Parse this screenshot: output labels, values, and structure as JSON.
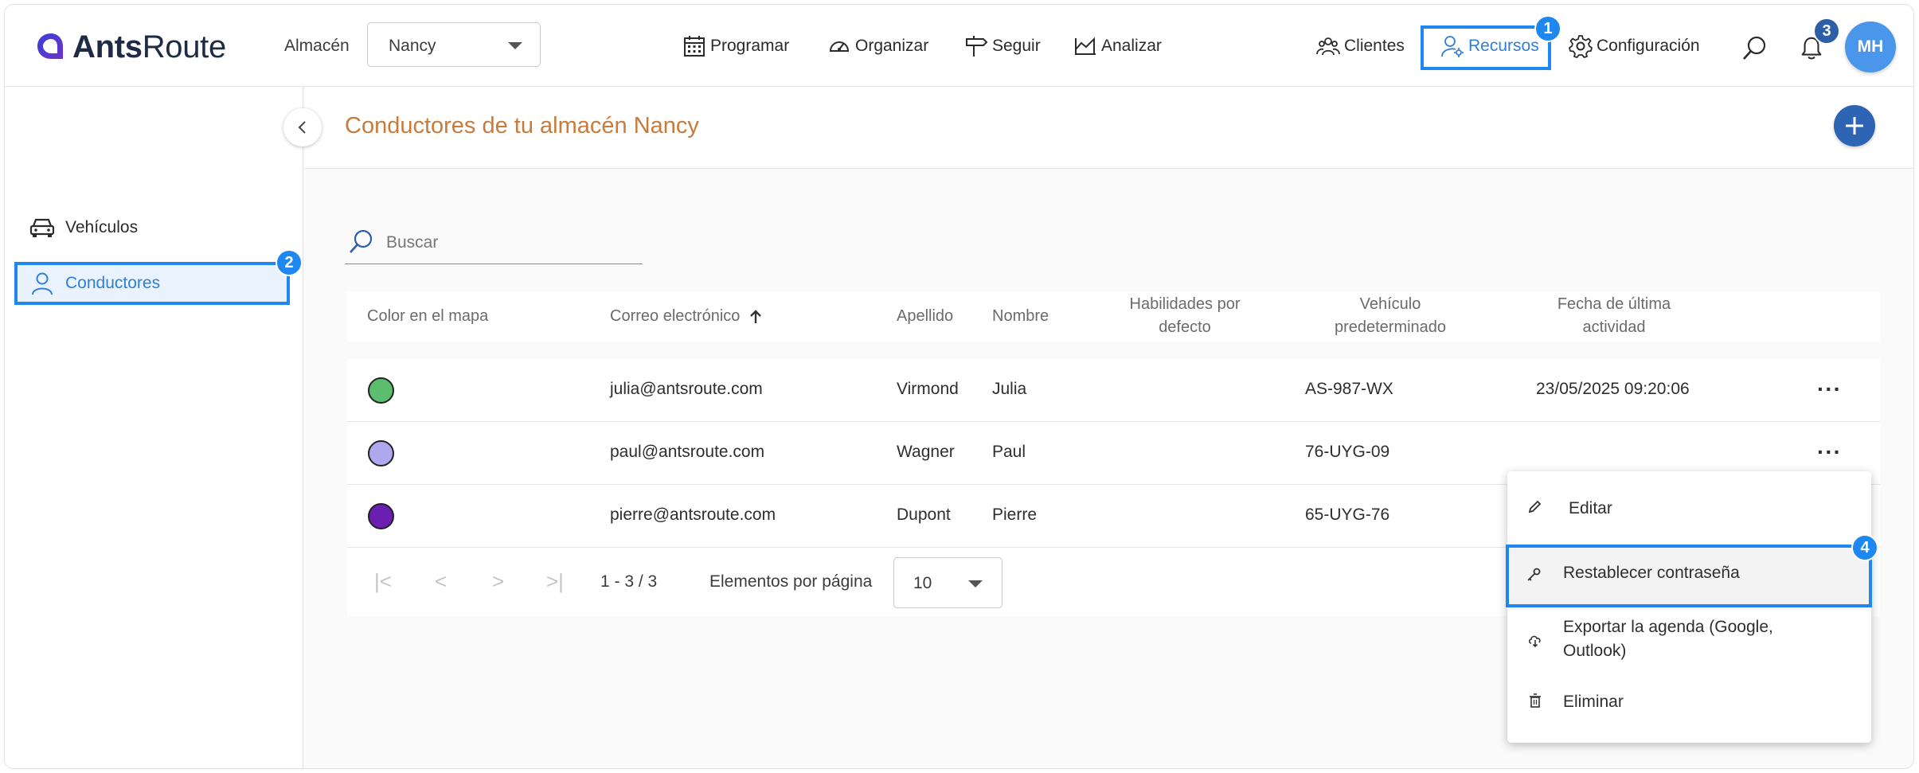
{
  "app": {
    "logo_bold": "Ants",
    "logo_light": "Route"
  },
  "header": {
    "warehouse_label": "Almacén",
    "warehouse_value": "Nancy",
    "nav": [
      {
        "label": "Programar",
        "icon": "calendar-icon"
      },
      {
        "label": "Organizar",
        "icon": "speedometer-icon"
      },
      {
        "label": "Seguir",
        "icon": "signpost-icon"
      },
      {
        "label": "Analizar",
        "icon": "chart-icon"
      }
    ],
    "right_nav": [
      {
        "label": "Clientes",
        "icon": "people-icon"
      },
      {
        "label": "Recursos",
        "icon": "user-gear-icon"
      },
      {
        "label": "Configuración",
        "icon": "gear-icon"
      }
    ],
    "avatar_initials": "MH"
  },
  "annotations": {
    "recursos": "1",
    "conductores": "2",
    "notifications": "3",
    "reset_password": "4"
  },
  "sidebar": {
    "items": [
      {
        "label": "Vehículos",
        "icon": "car-icon"
      },
      {
        "label": "Conductores",
        "icon": "user-icon"
      }
    ]
  },
  "main": {
    "title": "Conductores de tu almacén Nancy",
    "search_placeholder": "Buscar",
    "columns": {
      "color": "Color en el mapa",
      "email": "Correo electrónico",
      "lastname": "Apellido",
      "firstname": "Nombre",
      "skills_1": "Habilidades por",
      "skills_2": "defecto",
      "vehicle_1": "Vehículo",
      "vehicle_2": "predeterminado",
      "activity_1": "Fecha de última",
      "activity_2": "actividad"
    },
    "rows": [
      {
        "color": "#5cbd6e",
        "email": "julia@antsroute.com",
        "lastname": "Virmond",
        "firstname": "Julia",
        "vehicle": "AS-987-WX",
        "activity": "23/05/2025 09:20:06"
      },
      {
        "color": "#b0a8ee",
        "email": "paul@antsroute.com",
        "lastname": "Wagner",
        "firstname": "Paul",
        "vehicle": "76-UYG-09",
        "activity": ""
      },
      {
        "color": "#6a1fb0",
        "email": "pierre@antsroute.com",
        "lastname": "Dupont",
        "firstname": "Pierre",
        "vehicle": "65-UYG-76",
        "activity": ""
      }
    ],
    "pager": {
      "range": "1 - 3 / 3",
      "per_page_label": "Elementos por página",
      "per_page_value": "10"
    }
  },
  "context_menu": {
    "edit": "Editar",
    "reset_password": "Restablecer contraseña",
    "export_1": "Exportar la agenda (Google,",
    "export_2": "Outlook)",
    "delete": "Eliminar"
  },
  "colors": {
    "accent": "#1e88f0",
    "title": "#c87b3a",
    "add_button": "#2d64b4"
  }
}
